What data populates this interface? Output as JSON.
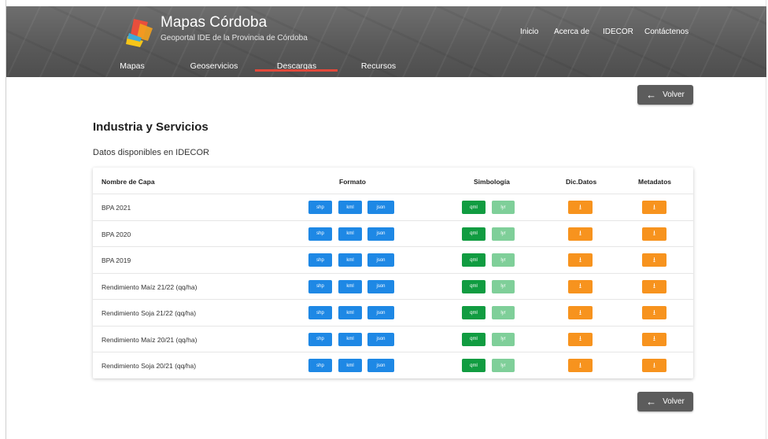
{
  "brand": {
    "title": "Mapas Córdoba",
    "subtitle": "Geoportal IDE de la Provincia de Córdoba"
  },
  "top_nav": [
    "Inicio",
    "Acerca de",
    "IDECOR",
    "Contáctenos"
  ],
  "main_nav": {
    "items": [
      "Mapas",
      "Geoservicios",
      "Descargas",
      "Recursos"
    ],
    "active": "Descargas"
  },
  "back_button": {
    "label": "Volver",
    "icon": "arrow-left-icon"
  },
  "page": {
    "title": "Industria y Servicios",
    "subtitle": "Datos disponibles en IDECOR"
  },
  "table": {
    "headers": {
      "name": "Nombre de Capa",
      "format": "Formato",
      "symbology": "Simbología",
      "dic": "Dic.Datos",
      "meta": "Metadatos"
    },
    "format_buttons": [
      "shp",
      "kml",
      "json"
    ],
    "symbology_buttons": [
      "qml",
      "lyr"
    ],
    "download_icon": "⭳",
    "rows": [
      "BPA 2021",
      "BPA 2020",
      "BPA 2019",
      "Rendimiento Maíz 21/22 (qq/ha)",
      "Rendimiento Soja 21/22 (qq/ha)",
      "Rendimiento Maíz 20/21 (qq/ha)",
      "Rendimiento Soja 20/21 (qq/ha)"
    ]
  },
  "colors": {
    "header_bg": "#5e5e5e",
    "active_tab": "#e2483a",
    "format_btn": "#1e88e5",
    "qml_btn": "#119c41",
    "lyr_btn": "#7fcf99",
    "download_btn": "#f7931e",
    "back_btn": "#5c5c5c"
  }
}
